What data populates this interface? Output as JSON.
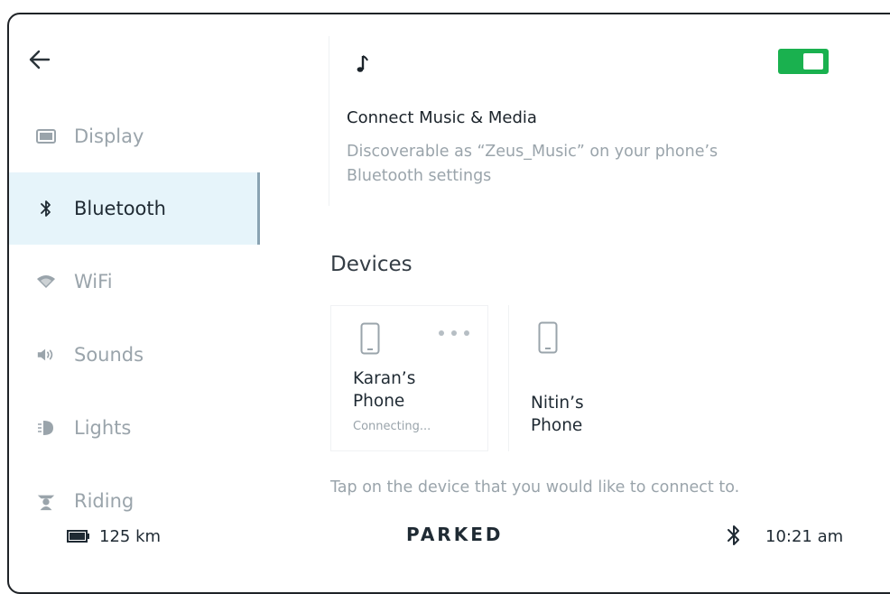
{
  "sidebar": {
    "back_icon": "arrow-left-icon",
    "items": [
      {
        "label": "Display",
        "icon": "display-icon",
        "active": false
      },
      {
        "label": "Bluetooth",
        "icon": "bluetooth-icon",
        "active": true
      },
      {
        "label": "WiFi",
        "icon": "wifi-icon",
        "active": false
      },
      {
        "label": "Sounds",
        "icon": "speaker-icon",
        "active": false
      },
      {
        "label": "Lights",
        "icon": "light-icon",
        "active": false
      },
      {
        "label": "Riding",
        "icon": "rider-icon",
        "active": false
      }
    ]
  },
  "media": {
    "icon": "music-note-icon",
    "toggle_on": true,
    "title": "Connect Music & Media",
    "description": "Discoverable as “Zeus_Music” on your phone’s Bluetooth settings"
  },
  "devices": {
    "heading": "Devices",
    "items": [
      {
        "name": "Karan’s\nPhone",
        "status": "Connecting...",
        "icon": "phone-icon",
        "menu_icon": "more-dots-icon"
      },
      {
        "name": "Nitin’s\nPhone",
        "status": "",
        "icon": "phone-icon"
      }
    ],
    "hint": "Tap on the device that you would like to connect to."
  },
  "status_bar": {
    "battery_icon": "battery-icon",
    "range": "125 km",
    "mode": "PARKED",
    "bt_icon": "bluetooth-icon",
    "time": "10:21 am"
  },
  "colors": {
    "accent_green": "#1ab14f",
    "active_bg": "#e6f4fa",
    "muted_text": "#9aa4ab"
  }
}
